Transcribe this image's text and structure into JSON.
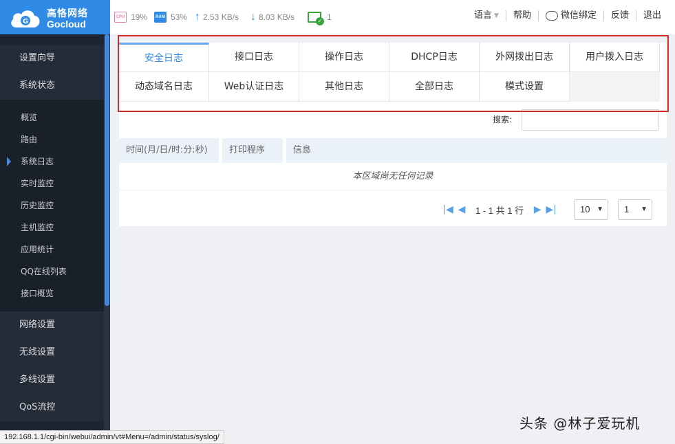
{
  "brand": {
    "name_cn": "高恪网络",
    "name_en": "Gocloud"
  },
  "status": {
    "cpu_label": "CPU",
    "cpu": "19%",
    "ram_label": "RAM",
    "ram": "53%",
    "upload": "2.53 KB/s",
    "download": "8.03 KB/s",
    "devices": "1"
  },
  "topnav": {
    "language": "语言",
    "help": "帮助",
    "wechat": "微信绑定",
    "feedback": "反馈",
    "logout": "退出"
  },
  "sidebar": {
    "setup": "设置向导",
    "status": "系统状态",
    "sub_items": [
      "概览",
      "路由",
      "系统日志",
      "实时监控",
      "历史监控",
      "主机监控",
      "应用统计",
      "QQ在线列表",
      "接口概览"
    ],
    "active_sub": "系统日志",
    "bottom_items": [
      "网络设置",
      "无线设置",
      "多线设置",
      "QoS流控"
    ]
  },
  "tabs": {
    "row1": [
      "安全日志",
      "接口日志",
      "操作日志",
      "DHCP日志",
      "外网拨出日志",
      "用户拨入日志"
    ],
    "row2": [
      "动态域名日志",
      "Web认证日志",
      "其他日志",
      "全部日志",
      "模式设置"
    ],
    "active": "安全日志"
  },
  "search": {
    "label": "搜索:",
    "value": ""
  },
  "table": {
    "columns": [
      "时间(月/日/时:分:秒)",
      "打印程序",
      "信息"
    ],
    "empty_text": "本区域尚无任何记录"
  },
  "pagination": {
    "summary": "1 - 1 共 1 行",
    "page_size": "10",
    "page": "1"
  },
  "status_url": "192.168.1.1/cgi-bin/webui/admin/vt#Menu=/admin/status/syslog/",
  "watermark": "头条 @林子爱玩机",
  "colors": {
    "brand": "#2f8be6",
    "sidebar": "#1d2530",
    "highlight": "#d32a2a"
  }
}
